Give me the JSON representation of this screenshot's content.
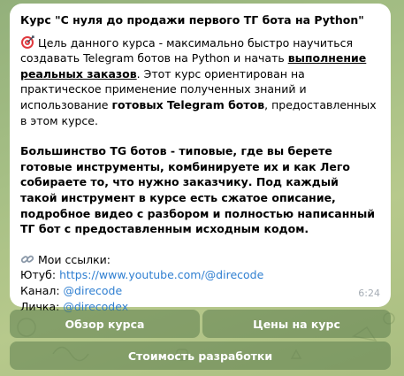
{
  "message": {
    "title": "Курс \"С нуля до продажи первого ТГ бота на Python\"",
    "para1": {
      "t1": "Цель данного курса - максимально быстро научиться создавать Telegram ботов на Python и начать ",
      "u1": "выполнение реальных заказов",
      "t2": ". Этот курс ориентирован на практическое применение полученных знаний и использование ",
      "b1": "готовых Telegram ботов",
      "t3": ", предоставленных в этом курсе."
    },
    "para2": "Большинство TG ботов - типовые, где вы берете готовые инструменты, комбинируете их и как Лего собираете то, что нужно заказчику. Под каждый такой инструмент в курсе есть сжатое описание, подробное видео с разбором и полностью написанный ТГ бот с предоставленным исходным кодом.",
    "links_heading": "Мои ссылки:",
    "youtube_label": "Ютуб: ",
    "youtube_url": "https://www.youtube.com/@direcode",
    "channel_label": "Канал: ",
    "channel_handle": "@direcode",
    "personal_label": "Личка: ",
    "personal_handle": "@direcodex",
    "time": "6:24",
    "icons": {
      "target": "dart-target-icon",
      "link": "link-chain-icon"
    }
  },
  "keyboard": {
    "buttons": [
      {
        "label": "Обзор курса"
      },
      {
        "label": "Цены на курс"
      },
      {
        "label": "Стоимость разработки"
      }
    ]
  },
  "colors": {
    "link": "#2f7fd1",
    "bubble": "#ffffff",
    "button_bg": "#5d7d4e",
    "time": "#a6adb5"
  }
}
